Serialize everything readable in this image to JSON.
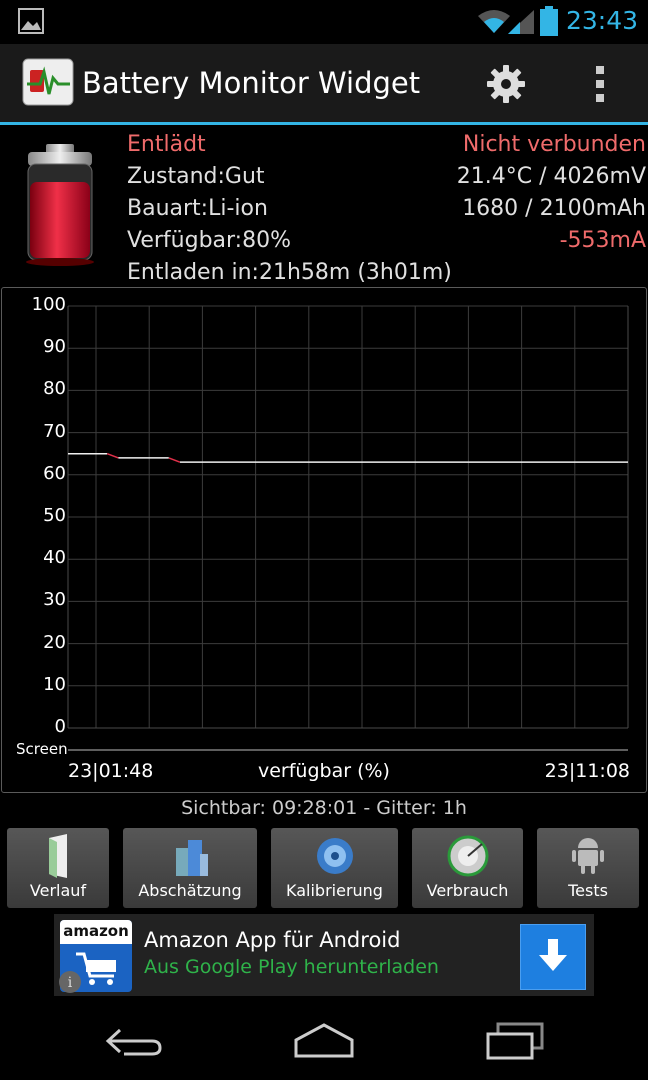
{
  "status_bar": {
    "time": "23:43"
  },
  "app": {
    "title": "Battery Monitor Widget"
  },
  "info": {
    "state": "Entlädt",
    "connection": "Nicht verbunden",
    "health": "Zustand:Gut",
    "temp_voltage": "21.4°C / 4026mV",
    "type": "Bauart:Li-ion",
    "capacity": "1680 / 2100mAh",
    "available": "Verfügbar:80%",
    "current": "-553mA",
    "discharge": "Entladen in:21h58m (3h01m)"
  },
  "chart_data": {
    "type": "line",
    "ylim": [
      0,
      100
    ],
    "y_ticks": [
      "100",
      "90",
      "80",
      "70",
      "60",
      "50",
      "40",
      "30",
      "20",
      "10",
      "0"
    ],
    "x_start_label": "23|01:48",
    "x_end_label": "23|11:08",
    "xlabel": "verfügbar (%)",
    "screen_label": "Screen",
    "series": [
      {
        "x": [
          0,
          0.07,
          0.09,
          0.18,
          0.2,
          1.0
        ],
        "values": [
          65,
          65,
          64,
          64,
          63,
          63
        ]
      }
    ]
  },
  "visible_range": "Sichtbar: 09:28:01 - Gitter: 1h",
  "tools": [
    {
      "label": "Verlauf"
    },
    {
      "label": "Abschätzung"
    },
    {
      "label": "Kalibrierung"
    },
    {
      "label": "Verbrauch"
    },
    {
      "label": "Tests"
    }
  ],
  "ad": {
    "logo_text": "amazon",
    "title": "Amazon App für Android",
    "subtitle": "Aus Google Play herunterladen"
  },
  "colors": {
    "accent": "#33b5e5",
    "warning": "#ef6b6b",
    "ad_green": "#2fb34a",
    "download_blue": "#1e7fe0"
  }
}
